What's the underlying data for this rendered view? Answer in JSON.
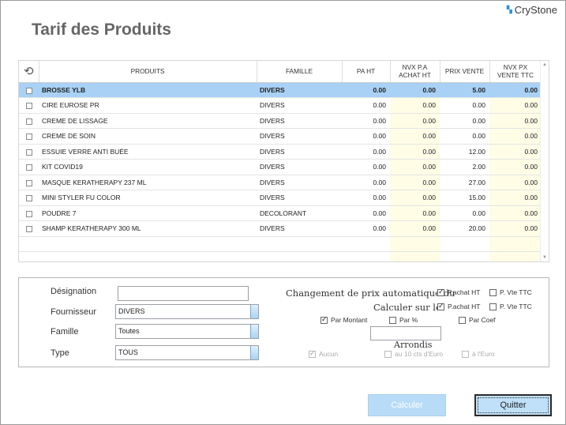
{
  "brand": {
    "name": "CryStone"
  },
  "page": {
    "title": "Tarif des Produits"
  },
  "grid": {
    "columns": {
      "produits": "PRODUITS",
      "famille": "FAMILLE",
      "pa_ht": "PA HT",
      "nvx_pa_l1": "NVX P.A",
      "nvx_pa_l2": "ACHAT HT",
      "prix_vente": "PRIX VENTE",
      "nvx_px_l1": "NVX PX",
      "nvx_px_l2": "VENTE TTC"
    },
    "rows": [
      {
        "produit": "BROSSE YLB",
        "famille": "DIVERS",
        "pa_ht": "0.00",
        "nvx_pa": "0.00",
        "prix_vente": "5.00",
        "nvx_px": "0.00",
        "selected": true
      },
      {
        "produit": "CIRE EUROSE PR",
        "famille": "DIVERS",
        "pa_ht": "0.00",
        "nvx_pa": "0.00",
        "prix_vente": "0.00",
        "nvx_px": "0.00"
      },
      {
        "produit": "CREME DE LISSAGE",
        "famille": "DIVERS",
        "pa_ht": "0.00",
        "nvx_pa": "0.00",
        "prix_vente": "0.00",
        "nvx_px": "0.00"
      },
      {
        "produit": "CREME DE SOIN",
        "famille": "DIVERS",
        "pa_ht": "0.00",
        "nvx_pa": "0.00",
        "prix_vente": "0.00",
        "nvx_px": "0.00"
      },
      {
        "produit": "ESSUIE VERRE ANTI BUÉE",
        "famille": "DIVERS",
        "pa_ht": "0.00",
        "nvx_pa": "0.00",
        "prix_vente": "12.00",
        "nvx_px": "0.00"
      },
      {
        "produit": "KIT COVID19",
        "famille": "DIVERS",
        "pa_ht": "0.00",
        "nvx_pa": "0.00",
        "prix_vente": "2.00",
        "nvx_px": "0.00"
      },
      {
        "produit": "MASQUE KERATHERAPY 237 ML",
        "famille": "DIVERS",
        "pa_ht": "0.00",
        "nvx_pa": "0.00",
        "prix_vente": "27.00",
        "nvx_px": "0.00"
      },
      {
        "produit": "MINI STYLER FU COLOR",
        "famille": "DIVERS",
        "pa_ht": "0.00",
        "nvx_pa": "0.00",
        "prix_vente": "15.00",
        "nvx_px": "0.00"
      },
      {
        "produit": "POUDRE 7",
        "famille": "DECOLORANT",
        "pa_ht": "0.00",
        "nvx_pa": "0.00",
        "prix_vente": "0.00",
        "nvx_px": "0.00"
      },
      {
        "produit": "SHAMP KERATHERAPY 300 ML",
        "famille": "DIVERS",
        "pa_ht": "0.00",
        "nvx_pa": "0.00",
        "prix_vente": "20.00",
        "nvx_px": "0.00"
      }
    ]
  },
  "filters": {
    "designation_label": "Désignation",
    "designation_value": "",
    "fournisseur_label": "Fournisseur",
    "fournisseur_value": "DIVERS",
    "famille_label": "Famille",
    "famille_value": "Toutes",
    "type_label": "Type",
    "type_value": "TOUS"
  },
  "options": {
    "changement_label": "Changement de prix automatique du",
    "calculer_label": "Calculer sur le",
    "pachat_ht": "P.achat HT",
    "p_vte_ttc": "P. Vte TTC",
    "par_montant": "Par Montant",
    "par_pct": "Par %",
    "par_coef": "Par Coef",
    "value_input": "",
    "arrondis_label": "Arrondis",
    "aucun": "Aucun",
    "au_10_cts": "au 10 cts d'Euro",
    "a_leuro": "à l'Euro",
    "state": {
      "changement_pachat": true,
      "changement_pvte": false,
      "calculer_pachat": true,
      "calculer_pvte": false,
      "par_montant": true,
      "par_pct": false,
      "par_coef": false,
      "aucun": true,
      "au_10_cts": false,
      "a_leuro": false
    }
  },
  "buttons": {
    "calculer": "Calculer",
    "quitter": "Quitter"
  }
}
